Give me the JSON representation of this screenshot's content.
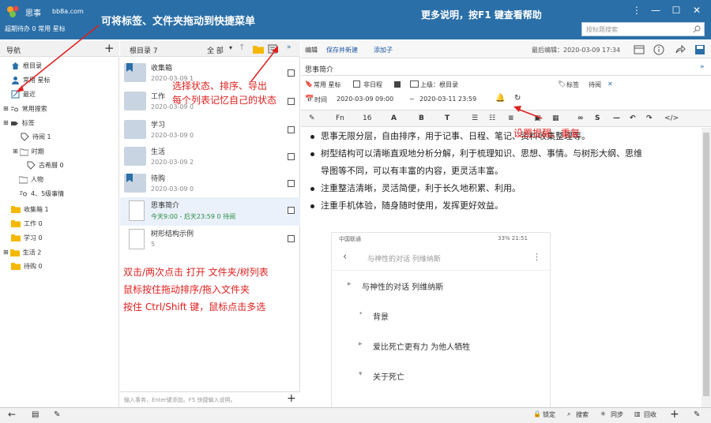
{
  "titlebar": {
    "app_name": "思事",
    "domain": "bb8a.com",
    "sub_line": "超期待办 0  常用 星标",
    "hint_drag": "可将标签、文件夹拖动到快捷菜单",
    "hint_help": "更多说明，按F1 键查看帮助",
    "search_placeholder": "按标题搜索"
  },
  "nav": {
    "header": "导航",
    "items": [
      {
        "label": "根目录",
        "icon": "home-icon"
      },
      {
        "label": "常用 星标",
        "icon": "person-icon"
      },
      {
        "label": "最近",
        "icon": "edit-icon"
      },
      {
        "label": "常用搜索",
        "icon": "search-list-icon"
      },
      {
        "label": "标签",
        "icon": "tag-dark-icon"
      },
      {
        "label": "待阅 1",
        "icon": "tag-icon"
      },
      {
        "label": "时期",
        "icon": "folder-gray-icon"
      },
      {
        "label": "古希腊 0",
        "icon": "tag-icon"
      },
      {
        "label": "人物",
        "icon": "folder-gray-icon"
      },
      {
        "label": "4、5级事情",
        "icon": "search-list-icon"
      },
      {
        "label": "收集箱 1",
        "icon": "folder-icon"
      },
      {
        "label": "工作 0",
        "icon": "folder-icon"
      },
      {
        "label": "学习 0",
        "icon": "folder-icon"
      },
      {
        "label": "生活 2",
        "icon": "folder-icon"
      },
      {
        "label": "待购 0",
        "icon": "folder-icon"
      }
    ]
  },
  "list": {
    "header": "根目录 7",
    "filter": "全 部",
    "rows": [
      {
        "title": "收集箱",
        "date": "2020-03-09  1"
      },
      {
        "title": "工作",
        "date": "2020-03-09  0"
      },
      {
        "title": "学习",
        "date": "2020-03-09  0"
      },
      {
        "title": "生活",
        "date": "2020-03-09  2"
      },
      {
        "title": "待购",
        "date": "2020-03-09  0"
      },
      {
        "title": "思事简介",
        "date": "今天9:00 - 后天23:59  0  待阅"
      },
      {
        "title": "树形结构示例",
        "date": "5"
      }
    ],
    "input_placeholder": "输入事务，Enter键添加。F5 快捷输入说明。"
  },
  "editor": {
    "tab_edit": "编辑",
    "save_new": "保存并新建",
    "add_child": "添加子",
    "last_edit": "最后编辑：2020-03-09 17:34",
    "title": "思事简介",
    "meta_common": "常用 星标",
    "meta_non_schedule": "非日程",
    "meta_parent": "上级：根目录",
    "meta_tag_label": "标签",
    "meta_tag_value": "待阅",
    "time_label": "时间",
    "time_start": "2020-03-09 09:00",
    "time_sep": "~",
    "time_end": "2020-03-11 23:59",
    "fmt_fn": "Fn",
    "fmt_size": "16",
    "bullets": [
      "思事无限分层，自由排序，用于记事、日程、笔记、资料收集整理等。",
      "树型结构可以清晰直观地分析分解，利于梳理知识、思想、事情。与树形大纲、思维",
      "导图等不同，可以有丰富的内容，更灵活丰富。",
      "注重整洁清晰，灵活简便，利于长久地积累、利用。",
      "注重手机体验，随身随时使用，发挥更好效益。"
    ],
    "phone": {
      "carrier": "中国联通",
      "status_right": "33%  21:51",
      "header_title": "与神性的对话  列维纳斯",
      "items": [
        "与神性的对话  列维纳斯",
        "背景",
        "爱比死亡更有力 为他人牺牲",
        "关于死亡"
      ]
    }
  },
  "annotations": {
    "select_state": "选择状态、排序、导出",
    "per_list": "每个列表记忆自己的状态",
    "reminder": "设置提醒、重复",
    "dblclick": "双击/两次点击 打开 文件夹/树列表",
    "drag_sort": "鼠标按住拖动排序/拖入文件夹",
    "multi_select": "按住 Ctrl/Shift 键，鼠标点击多选"
  },
  "footer": {
    "lock": "锁定",
    "search": "搜索",
    "sync": "同步",
    "recycle": "回收"
  },
  "colors": {
    "titlebar": "#2a6fa8",
    "annotation": "#e02020",
    "link": "#1a56a0"
  }
}
